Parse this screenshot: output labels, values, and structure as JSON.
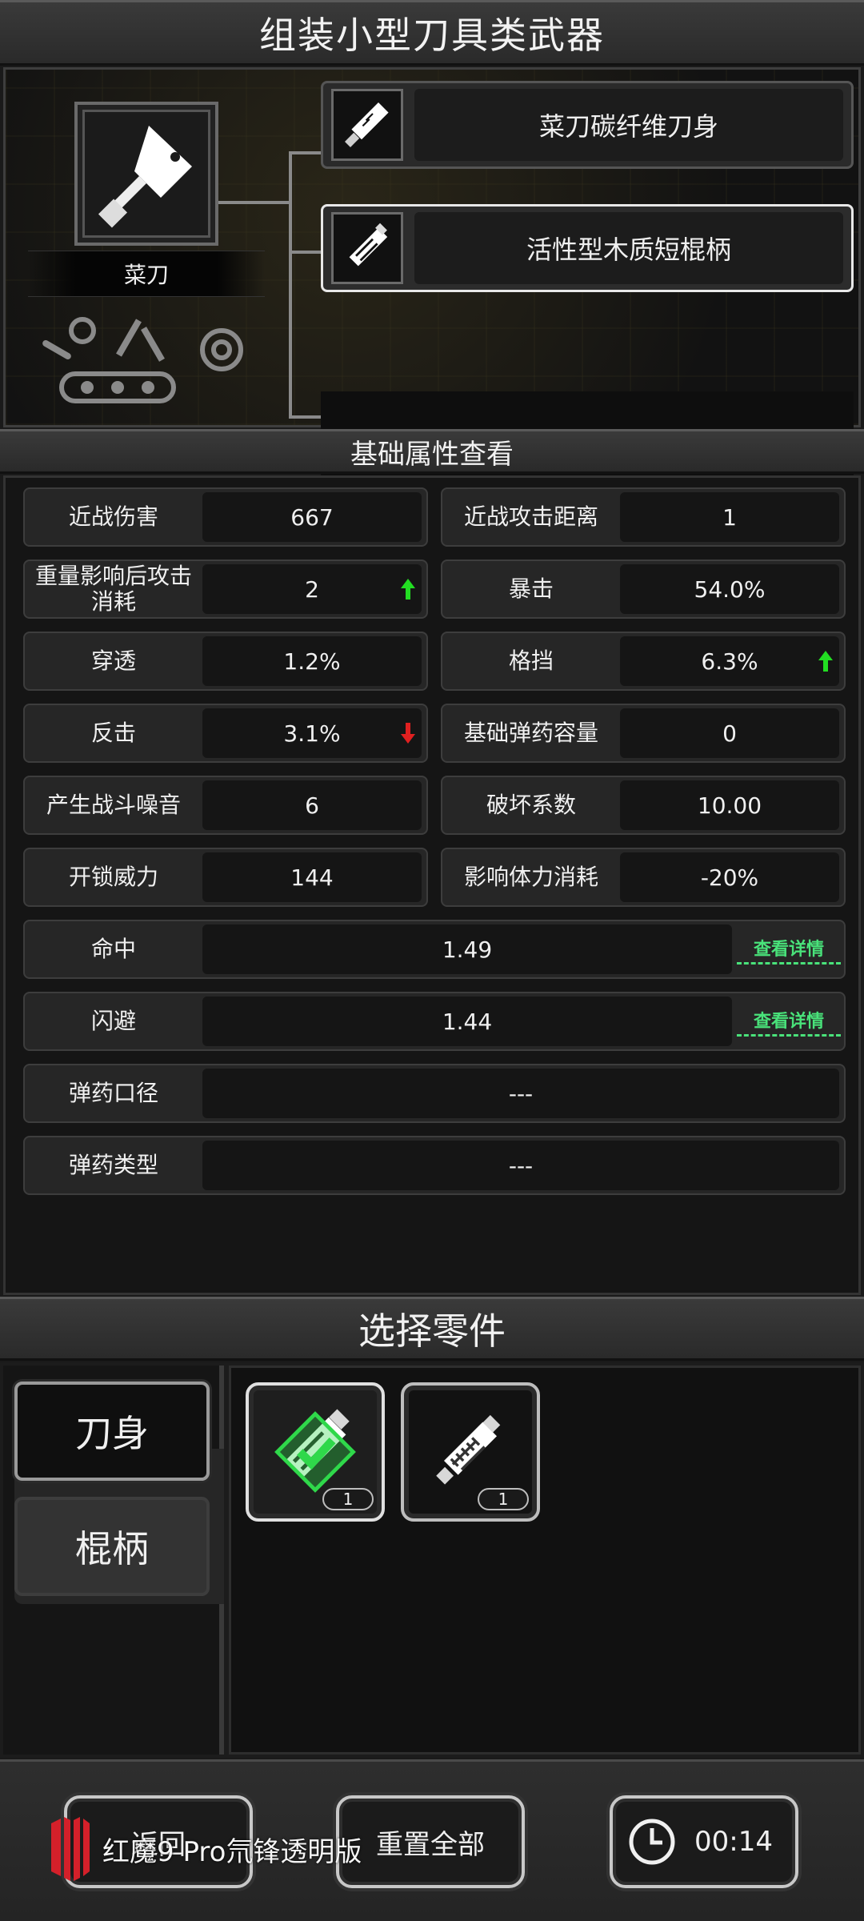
{
  "title": "组装小型刀具类武器",
  "weapon": {
    "name": "菜刀"
  },
  "parts": {
    "blade": "菜刀碳纤维刀身",
    "handle": "活性型木质短棍柄"
  },
  "sections": {
    "attributes": "基础属性查看",
    "select_parts": "选择零件"
  },
  "attributes": [
    {
      "label": "近战伤害",
      "value": "667"
    },
    {
      "label": "近战攻击距离",
      "value": "1"
    },
    {
      "label": "重量影响后攻击消耗",
      "value": "2",
      "trend": "up"
    },
    {
      "label": "暴击",
      "value": "54.0%"
    },
    {
      "label": "穿透",
      "value": "1.2%"
    },
    {
      "label": "格挡",
      "value": "6.3%",
      "trend": "up"
    },
    {
      "label": "反击",
      "value": "3.1%",
      "trend": "down"
    },
    {
      "label": "基础弹药容量",
      "value": "0"
    },
    {
      "label": "产生战斗噪音",
      "value": "6"
    },
    {
      "label": "破坏系数",
      "value": "10.00"
    },
    {
      "label": "开锁威力",
      "value": "144"
    },
    {
      "label": "影响体力消耗",
      "value": "-20%"
    }
  ],
  "wide_attributes": [
    {
      "label": "命中",
      "value": "1.49",
      "link": "查看详情"
    },
    {
      "label": "闪避",
      "value": "1.44",
      "link": "查看详情"
    },
    {
      "label": "弹药口径",
      "value": "---"
    },
    {
      "label": "弹药类型",
      "value": "---"
    }
  ],
  "categories": [
    "刀身",
    "棍柄"
  ],
  "selected_category": "棍柄",
  "items": [
    {
      "icon": "wooden-handle-icon",
      "count": "1",
      "selected": true
    },
    {
      "icon": "wrapped-handle-icon",
      "count": "1",
      "selected": false
    }
  ],
  "buttons": {
    "back": "返回",
    "reset": "重置全部"
  },
  "timer": "00:14",
  "watermark": "红魔9 Pro氘锋透明版",
  "colors": {
    "accent_green": "#49e27a",
    "trend_up": "#22dd22",
    "trend_down": "#e02020",
    "check_green": "#2fd84a"
  }
}
